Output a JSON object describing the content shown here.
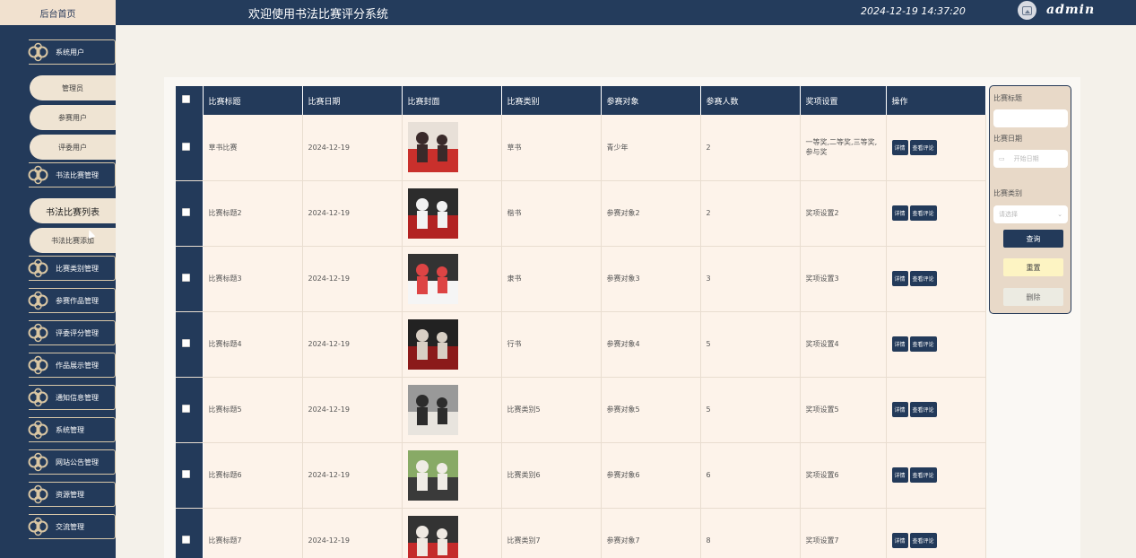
{
  "header": {
    "home_tab": "后台首页",
    "title": "欢迎使用书法比赛评分系统",
    "datetime": "2024-12-19 14:37:20",
    "user": "admin"
  },
  "sidebar": {
    "groups": [
      {
        "label": "系统用户",
        "sub": [
          "管理员",
          "参赛用户",
          "评委用户"
        ]
      },
      {
        "label": "书法比赛管理",
        "sub": [
          "书法比赛列表",
          "书法比赛添加"
        ]
      },
      {
        "label": "比赛类别管理"
      },
      {
        "label": "参赛作品管理"
      },
      {
        "label": "评委评分管理"
      },
      {
        "label": "作品展示管理"
      },
      {
        "label": "通知信息管理"
      },
      {
        "label": "系统管理"
      },
      {
        "label": "网站公告管理"
      },
      {
        "label": "资源管理"
      },
      {
        "label": "交流管理"
      }
    ]
  },
  "table": {
    "columns": [
      "比赛标题",
      "比赛日期",
      "比赛封面",
      "比赛类别",
      "参赛对象",
      "参赛人数",
      "奖项设置",
      "操作"
    ],
    "detail_label": "详情",
    "comment_label": "查看评论",
    "rows": [
      {
        "title": "草书比赛",
        "date": "2024-12-19",
        "category": "草书",
        "target": "青少年",
        "count": "2",
        "award": "一等奖,二等奖,三等奖,参与奖"
      },
      {
        "title": "比赛标题2",
        "date": "2024-12-19",
        "category": "楷书",
        "target": "参赛对象2",
        "count": "2",
        "award": "奖项设置2"
      },
      {
        "title": "比赛标题3",
        "date": "2024-12-19",
        "category": "隶书",
        "target": "参赛对象3",
        "count": "3",
        "award": "奖项设置3"
      },
      {
        "title": "比赛标题4",
        "date": "2024-12-19",
        "category": "行书",
        "target": "参赛对象4",
        "count": "5",
        "award": "奖项设置4"
      },
      {
        "title": "比赛标题5",
        "date": "2024-12-19",
        "category": "比赛类别5",
        "target": "参赛对象5",
        "count": "5",
        "award": "奖项设置5"
      },
      {
        "title": "比赛标题6",
        "date": "2024-12-19",
        "category": "比赛类别6",
        "target": "参赛对象6",
        "count": "6",
        "award": "奖项设置6"
      },
      {
        "title": "比赛标题7",
        "date": "2024-12-19",
        "category": "比赛类别7",
        "target": "参赛对象7",
        "count": "8",
        "award": "奖项设置7"
      }
    ]
  },
  "search": {
    "title_label": "比赛标题",
    "date_label": "比赛日期",
    "date_placeholder": "开始日期",
    "category_label": "比赛类别",
    "category_placeholder": "请选择",
    "query_button": "查询",
    "reset_button": "重置",
    "delete_button": "删除"
  },
  "colors": {
    "navy": "#233a5a",
    "cream": "#efe4d3",
    "row_bg": "#fdf3ea",
    "reset_yellow": "#fdf4c3"
  }
}
